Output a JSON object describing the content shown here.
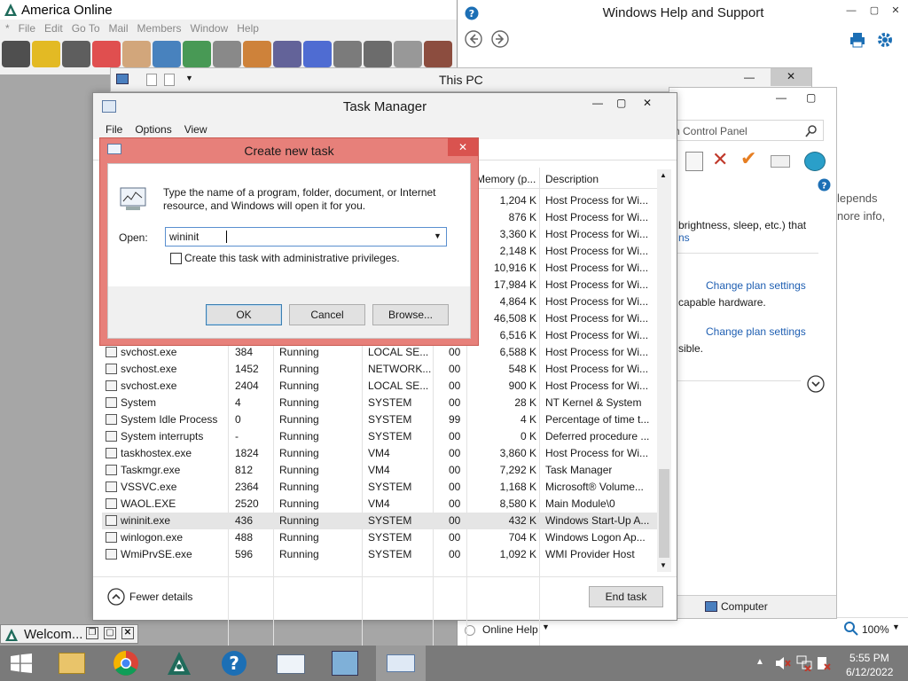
{
  "colors": {
    "dialog_border": "#e7807a",
    "taskbar": "#7a7a7a",
    "link": "#1f5fb2",
    "selection": "#e5e5e5"
  },
  "aol": {
    "title": "America Online",
    "menu": [
      "*",
      "File",
      "Edit",
      "Go To",
      "Mail",
      "Members",
      "Window",
      "Help"
    ],
    "toolbar_icons": [
      "speech-bubble-icon",
      "pencil-icon",
      "remote-icon",
      "hot-icon",
      "people-icon",
      "globe-mail-icon",
      "stock-chart-icon",
      "news-icon",
      "globe-icon",
      "shopping-cart-icon",
      "star-icon",
      "clock-icon",
      "printer-icon",
      "file-icon",
      "cabinet-icon"
    ]
  },
  "help": {
    "title": "Windows Help and Support",
    "online_help": "Online Help",
    "zoom": "100%"
  },
  "thispc": {
    "title": "This PC"
  },
  "cpanel": {
    "search_placeholder": "h Control Panel",
    "text1": "lepends",
    "text2": "nore info,",
    "text3": "brightness, sleep, etc.) that",
    "text4": "ns",
    "link1": "Change plan settings",
    "text5": "capable hardware.",
    "link2": "Change plan settings",
    "text6": "sible.",
    "status": "Computer"
  },
  "taskmgr": {
    "title": "Task Manager",
    "menu": [
      "File",
      "Options",
      "View"
    ],
    "col_memory": "Memory (p...",
    "col_description": "Description",
    "top_rows": [
      {
        "mem": "1,204 K",
        "desc": "Host Process for Wi..."
      },
      {
        "mem": "876 K",
        "desc": "Host Process for Wi..."
      },
      {
        "mem": "3,360 K",
        "desc": "Host Process for Wi..."
      },
      {
        "mem": "2,148 K",
        "desc": "Host Process for Wi..."
      },
      {
        "mem": "10,916 K",
        "desc": "Host Process for Wi..."
      },
      {
        "mem": "17,984 K",
        "desc": "Host Process for Wi..."
      },
      {
        "mem": "4,864 K",
        "desc": "Host Process for Wi..."
      },
      {
        "mem": "46,508 K",
        "desc": "Host Process for Wi..."
      },
      {
        "mem": "6,516 K",
        "desc": "Host Process for Wi..."
      }
    ],
    "rows": [
      {
        "name": "svchost.exe",
        "pid": "384",
        "status": "Running",
        "user": "LOCAL SE...",
        "cpu": "00",
        "mem": "6,588 K",
        "desc": "Host Process for Wi..."
      },
      {
        "name": "svchost.exe",
        "pid": "1452",
        "status": "Running",
        "user": "NETWORK...",
        "cpu": "00",
        "mem": "548 K",
        "desc": "Host Process for Wi..."
      },
      {
        "name": "svchost.exe",
        "pid": "2404",
        "status": "Running",
        "user": "LOCAL SE...",
        "cpu": "00",
        "mem": "900 K",
        "desc": "Host Process for Wi..."
      },
      {
        "name": "System",
        "pid": "4",
        "status": "Running",
        "user": "SYSTEM",
        "cpu": "00",
        "mem": "28 K",
        "desc": "NT Kernel & System"
      },
      {
        "name": "System Idle Process",
        "pid": "0",
        "status": "Running",
        "user": "SYSTEM",
        "cpu": "99",
        "mem": "4 K",
        "desc": "Percentage of time t..."
      },
      {
        "name": "System interrupts",
        "pid": "-",
        "status": "Running",
        "user": "SYSTEM",
        "cpu": "00",
        "mem": "0 K",
        "desc": "Deferred procedure ..."
      },
      {
        "name": "taskhostex.exe",
        "pid": "1824",
        "status": "Running",
        "user": "VM4",
        "cpu": "00",
        "mem": "3,860 K",
        "desc": "Host Process for Wi..."
      },
      {
        "name": "Taskmgr.exe",
        "pid": "812",
        "status": "Running",
        "user": "VM4",
        "cpu": "00",
        "mem": "7,292 K",
        "desc": "Task Manager"
      },
      {
        "name": "VSSVC.exe",
        "pid": "2364",
        "status": "Running",
        "user": "SYSTEM",
        "cpu": "00",
        "mem": "1,168 K",
        "desc": "Microsoft® Volume..."
      },
      {
        "name": "WAOL.EXE",
        "pid": "2520",
        "status": "Running",
        "user": "VM4",
        "cpu": "00",
        "mem": "8,580 K",
        "desc": "Main Module\\0"
      },
      {
        "name": "wininit.exe",
        "pid": "436",
        "status": "Running",
        "user": "SYSTEM",
        "cpu": "00",
        "mem": "432 K",
        "desc": "Windows Start-Up A..."
      },
      {
        "name": "winlogon.exe",
        "pid": "488",
        "status": "Running",
        "user": "SYSTEM",
        "cpu": "00",
        "mem": "704 K",
        "desc": "Windows Logon Ap..."
      },
      {
        "name": "WmiPrvSE.exe",
        "pid": "596",
        "status": "Running",
        "user": "SYSTEM",
        "cpu": "00",
        "mem": "1,092 K",
        "desc": "WMI Provider Host"
      }
    ],
    "fewer_details": "Fewer details",
    "end_task": "End task"
  },
  "dialog": {
    "title": "Create new task",
    "description": "Type the name of a program, folder, document, or Internet resource, and Windows will open it for you.",
    "open_label": "Open:",
    "open_value": "wininit",
    "admin_label": "Create this task with administrative privileges.",
    "ok": "OK",
    "cancel": "Cancel",
    "browse": "Browse..."
  },
  "minimized": {
    "title": "Welcom..."
  },
  "taskbar": {
    "time": "5:55 PM",
    "date": "6/12/2022"
  }
}
